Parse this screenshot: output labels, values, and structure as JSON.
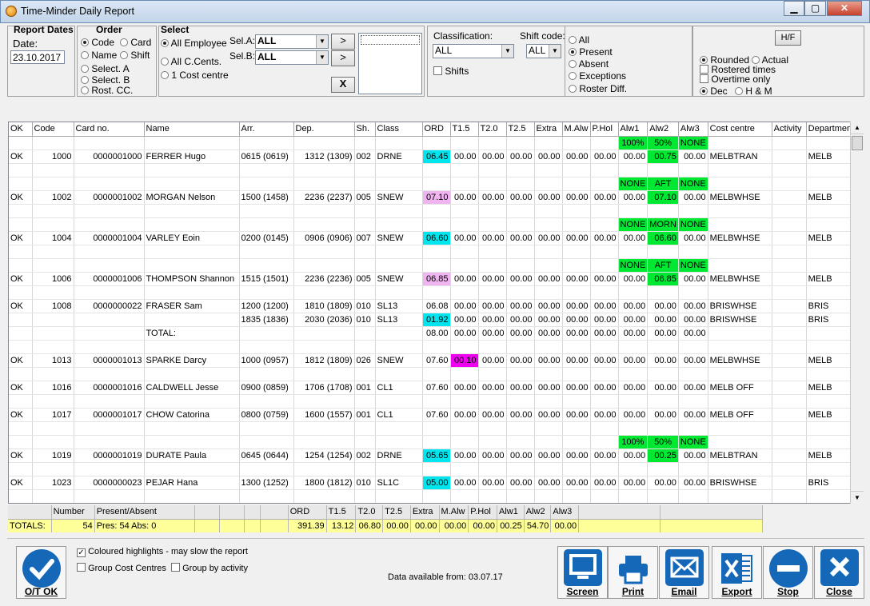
{
  "window": {
    "title": "Time-Minder Daily Report",
    "min": "▁",
    "max": "▢",
    "close": "✕"
  },
  "report_dates": {
    "heading": "Report Dates",
    "date_label": "Date:",
    "date_value": "23.10.2017"
  },
  "order": {
    "heading": "Order",
    "opts": [
      "Code",
      "Card",
      "Name",
      "Shift",
      "Select. A",
      "Select. B",
      "Rost. CC."
    ],
    "selected": "Code"
  },
  "select": {
    "heading": "Select",
    "opts": [
      "All Employee",
      "All C.Cents.",
      "1 Cost centre"
    ],
    "selected": "All Employee",
    "sel_a_label": "Sel.A:",
    "sel_a_value": "ALL",
    "sel_b_label": "Sel.B:",
    "sel_b_value": "ALL",
    "btn_a": ">",
    "btn_b": ">",
    "btn_x": "X"
  },
  "classification": {
    "label": "Classification:",
    "value": "ALL",
    "shift_label": "Shift code:",
    "shift_value": "ALL",
    "shifts_label": "Shifts"
  },
  "status_filter": {
    "opts": [
      "All",
      "Present",
      "Absent",
      "Exceptions",
      "Roster Diff."
    ],
    "selected": "Present"
  },
  "display_opts": {
    "hf": "H/F",
    "rounded": "Rounded",
    "actual": "Actual",
    "rostered": "Rostered times",
    "overtime": "Overtime only",
    "dec": "Dec",
    "hm": "H & M"
  },
  "grid": {
    "columns": [
      "OK",
      "Code",
      "Card no.",
      "Name",
      "Arr.",
      "Dep.",
      "Sh.",
      "Class",
      "ORD",
      "T1.5",
      "T2.0",
      "T2.5",
      "Extra",
      "M.Alw",
      "P.Hol",
      "Alw1",
      "Alw2",
      "Alw3",
      "Cost centre",
      "Activity",
      "Department"
    ],
    "rows": [
      {
        "kind": "alw",
        "a1": "100%",
        "a2": "50%",
        "a3": "NONE"
      },
      {
        "kind": "data",
        "ok": "OK",
        "code": "1000",
        "card": "0000001000",
        "name": "FERRER Hugo",
        "arr": "0615 (0619)",
        "dep": "1312 (1309)",
        "sh": "002",
        "cls": "DRNE",
        "ord": "06.45",
        "ordc": "cyan",
        "t15": "00.00",
        "t15c": "",
        "t20": "00.00",
        "t25": "00.00",
        "extra": "00.00",
        "malw": "00.00",
        "phol": "00.00",
        "alw1": "00.00",
        "alw2": "00.75",
        "alw2c": "green",
        "alw3": "00.00",
        "cc": "MELBTRAN",
        "act": "",
        "dept": "MELB"
      },
      {
        "kind": "blank"
      },
      {
        "kind": "alw",
        "a1": "NONE",
        "a2": "AFT",
        "a3": "NONE"
      },
      {
        "kind": "data",
        "ok": "OK",
        "code": "1002",
        "card": "0000001002",
        "name": "MORGAN Nelson",
        "arr": "1500 (1458)",
        "dep": "2236 (2237)",
        "sh": "005",
        "cls": "SNEW",
        "ord": "07.10",
        "ordc": "pink",
        "t15": "00.00",
        "t15c": "",
        "t20": "00.00",
        "t25": "00.00",
        "extra": "00.00",
        "malw": "00.00",
        "phol": "00.00",
        "alw1": "00.00",
        "alw2": "07.10",
        "alw2c": "green",
        "alw3": "00.00",
        "cc": "MELBWHSE",
        "act": "",
        "dept": "MELB"
      },
      {
        "kind": "blank"
      },
      {
        "kind": "alw",
        "a1": "NONE",
        "a2": "MORN",
        "a3": "NONE"
      },
      {
        "kind": "data",
        "ok": "OK",
        "code": "1004",
        "card": "0000001004",
        "name": "VARLEY Eoin",
        "arr": "0200 (0145)",
        "dep": "0906 (0906)",
        "sh": "007",
        "cls": "SNEW",
        "ord": "06.60",
        "ordc": "cyan",
        "t15": "00.00",
        "t15c": "",
        "t20": "00.00",
        "t25": "00.00",
        "extra": "00.00",
        "malw": "00.00",
        "phol": "00.00",
        "alw1": "00.00",
        "alw2": "06.60",
        "alw2c": "green",
        "alw3": "00.00",
        "cc": "MELBWHSE",
        "act": "",
        "dept": "MELB"
      },
      {
        "kind": "blank"
      },
      {
        "kind": "alw",
        "a1": "NONE",
        "a2": "AFT",
        "a3": "NONE"
      },
      {
        "kind": "data",
        "ok": "OK",
        "code": "1006",
        "card": "0000001006",
        "name": "THOMPSON Shannon",
        "arr": "1515 (1501)",
        "dep": "2236 (2236)",
        "sh": "005",
        "cls": "SNEW",
        "ord": "06.85",
        "ordc": "pink",
        "t15": "00.00",
        "t15c": "",
        "t20": "00.00",
        "t25": "00.00",
        "extra": "00.00",
        "malw": "00.00",
        "phol": "00.00",
        "alw1": "00.00",
        "alw2": "06.85",
        "alw2c": "green",
        "alw3": "00.00",
        "cc": "MELBWHSE",
        "act": "",
        "dept": "MELB"
      },
      {
        "kind": "blank"
      },
      {
        "kind": "data",
        "ok": "OK",
        "code": "1008",
        "card": "0000000022",
        "name": "FRASER Sam",
        "arr": "1200 (1200)",
        "dep": "1810 (1809)",
        "sh": "010",
        "cls": "SL13",
        "ord": "06.08",
        "ordc": "",
        "t15": "00.00",
        "t15c": "",
        "t20": "00.00",
        "t25": "00.00",
        "extra": "00.00",
        "malw": "00.00",
        "phol": "00.00",
        "alw1": "00.00",
        "alw2": "00.00",
        "alw2c": "",
        "alw3": "00.00",
        "cc": "BRISWHSE",
        "act": "",
        "dept": "BRIS"
      },
      {
        "kind": "data",
        "ok": "",
        "code": "",
        "card": "",
        "name": "",
        "arr": "1835 (1836)",
        "dep": "2030 (2036)",
        "sh": "010",
        "cls": "SL13",
        "ord": "01.92",
        "ordc": "cyan",
        "t15": "00.00",
        "t15c": "",
        "t20": "00.00",
        "t25": "00.00",
        "extra": "00.00",
        "malw": "00.00",
        "phol": "00.00",
        "alw1": "00.00",
        "alw2": "00.00",
        "alw2c": "",
        "alw3": "00.00",
        "cc": "BRISWHSE",
        "act": "",
        "dept": "BRIS"
      },
      {
        "kind": "data",
        "ok": "",
        "code": "",
        "card": "",
        "name": "TOTAL:",
        "arr": "",
        "dep": "",
        "sh": "",
        "cls": "",
        "ord": "08.00",
        "ordc": "",
        "t15": "00.00",
        "t15c": "",
        "t20": "00.00",
        "t25": "00.00",
        "extra": "00.00",
        "malw": "00.00",
        "phol": "00.00",
        "alw1": "00.00",
        "alw2": "00.00",
        "alw2c": "",
        "alw3": "00.00",
        "cc": "",
        "act": "",
        "dept": ""
      },
      {
        "kind": "blank"
      },
      {
        "kind": "data",
        "ok": "OK",
        "code": "1013",
        "card": "0000001013",
        "name": "SPARKE Darcy",
        "arr": "1000 (0957)",
        "dep": "1812 (1809)",
        "sh": "026",
        "cls": "SNEW",
        "ord": "07.60",
        "ordc": "",
        "t15": "00.10",
        "t15c": "mag",
        "t20": "00.00",
        "t25": "00.00",
        "extra": "00.00",
        "malw": "00.00",
        "phol": "00.00",
        "alw1": "00.00",
        "alw2": "00.00",
        "alw2c": "",
        "alw3": "00.00",
        "cc": "MELBWHSE",
        "act": "",
        "dept": "MELB"
      },
      {
        "kind": "blank"
      },
      {
        "kind": "data",
        "ok": "OK",
        "code": "1016",
        "card": "0000001016",
        "name": "CALDWELL Jesse",
        "arr": "0900 (0859)",
        "dep": "1706 (1708)",
        "sh": "001",
        "cls": "CL1",
        "ord": "07.60",
        "ordc": "",
        "t15": "00.00",
        "t15c": "",
        "t20": "00.00",
        "t25": "00.00",
        "extra": "00.00",
        "malw": "00.00",
        "phol": "00.00",
        "alw1": "00.00",
        "alw2": "00.00",
        "alw2c": "",
        "alw3": "00.00",
        "cc": "MELB OFF",
        "act": "",
        "dept": "MELB"
      },
      {
        "kind": "blank"
      },
      {
        "kind": "data",
        "ok": "OK",
        "code": "1017",
        "card": "0000001017",
        "name": "CHOW Catorina",
        "arr": "0800 (0759)",
        "dep": "1600 (1557)",
        "sh": "001",
        "cls": "CL1",
        "ord": "07.60",
        "ordc": "",
        "t15": "00.00",
        "t15c": "",
        "t20": "00.00",
        "t25": "00.00",
        "extra": "00.00",
        "malw": "00.00",
        "phol": "00.00",
        "alw1": "00.00",
        "alw2": "00.00",
        "alw2c": "",
        "alw3": "00.00",
        "cc": "MELB OFF",
        "act": "",
        "dept": "MELB"
      },
      {
        "kind": "blank"
      },
      {
        "kind": "alw",
        "a1": "100%",
        "a2": "50%",
        "a3": "NONE"
      },
      {
        "kind": "data",
        "ok": "OK",
        "code": "1019",
        "card": "0000001019",
        "name": "DURATE Paula",
        "arr": "0645 (0644)",
        "dep": "1254 (1254)",
        "sh": "002",
        "cls": "DRNE",
        "ord": "05.65",
        "ordc": "cyan",
        "t15": "00.00",
        "t15c": "",
        "t20": "00.00",
        "t25": "00.00",
        "extra": "00.00",
        "malw": "00.00",
        "phol": "00.00",
        "alw1": "00.00",
        "alw2": "00.25",
        "alw2c": "green",
        "alw3": "00.00",
        "cc": "MELBTRAN",
        "act": "",
        "dept": "MELB"
      },
      {
        "kind": "blank"
      },
      {
        "kind": "data",
        "ok": "OK",
        "code": "1023",
        "card": "0000000023",
        "name": "PEJAR Hana",
        "arr": "1300 (1252)",
        "dep": "1800 (1812)",
        "sh": "010",
        "cls": "SL1C",
        "ord": "05.00",
        "ordc": "cyan",
        "t15": "00.00",
        "t15c": "",
        "t20": "00.00",
        "t25": "00.00",
        "extra": "00.00",
        "malw": "00.00",
        "phol": "00.00",
        "alw1": "00.00",
        "alw2": "00.00",
        "alw2c": "",
        "alw3": "00.00",
        "cc": "BRISWHSE",
        "act": "",
        "dept": "BRIS"
      },
      {
        "kind": "blank"
      }
    ]
  },
  "totals": {
    "headers": [
      "",
      "Number",
      "Present/Absent",
      "",
      "",
      "",
      "",
      "ORD",
      "T1.5",
      "T2.0",
      "T2.5",
      "Extra",
      "M.Alw",
      "P.Hol",
      "Alw1",
      "Alw2",
      "Alw3",
      "",
      ""
    ],
    "values": [
      "TOTALS:",
      "54",
      "Pres: 54  Abs: 0",
      "",
      "",
      "",
      "",
      "391.39",
      "13.12",
      "06.80",
      "00.00",
      "00.00",
      "00.00",
      "00.00",
      "00.25",
      "54.70",
      "00.00",
      "",
      ""
    ]
  },
  "footer": {
    "ot_ok": "O/T OK",
    "coloured": "Coloured highlights - may slow the report",
    "group_cc": "Group Cost Centres",
    "group_act": "Group by activity",
    "data_available": "Data available from:  03.07.17",
    "buttons": [
      "Screen",
      "Print",
      "Email",
      "Export",
      "Stop",
      "Close"
    ]
  },
  "colors": {
    "cyan": "#00e5ee",
    "pink": "#f0b4f0",
    "magenta": "#f000f0",
    "green": "#00e832",
    "totals_bg": "#ffff99",
    "button_blue": "#1568b8"
  }
}
